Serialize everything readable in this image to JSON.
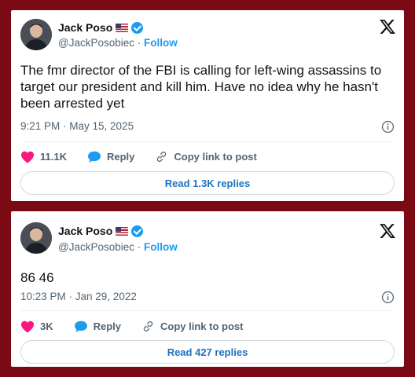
{
  "tweets": [
    {
      "author_name": "Jack Poso",
      "handle": "@JackPosobiec",
      "separator": " · ",
      "follow_label": "Follow",
      "text": "The fmr director of the FBI is calling for left-wing assassins to target our president and kill him. Have no idea why he hasn't been arrested yet",
      "timestamp": "9:21 PM · May 15, 2025",
      "likes": "11.1K",
      "reply_label": "Reply",
      "copy_link_label": "Copy link to post",
      "read_replies_label": "Read 1.3K replies"
    },
    {
      "author_name": "Jack Poso",
      "handle": "@JackPosobiec",
      "separator": " · ",
      "follow_label": "Follow",
      "text": "86 46",
      "timestamp": "10:23 PM · Jan 29, 2022",
      "likes": "3K",
      "reply_label": "Reply",
      "copy_link_label": "Copy link to post",
      "read_replies_label": "Read 427 replies"
    }
  ],
  "icons": {
    "brand": "x-logo-icon",
    "like": "heart-icon",
    "reply": "speech-bubble-icon",
    "copy": "link-icon",
    "info": "info-icon",
    "verified": "verified-badge-icon",
    "flag": "us-flag-icon"
  },
  "colors": {
    "background": "#7a0a14",
    "heart": "#f91880",
    "reply_bubble": "#1d9bf0",
    "link_accent": "#1d71c2",
    "verified": "#1d9bf0"
  }
}
